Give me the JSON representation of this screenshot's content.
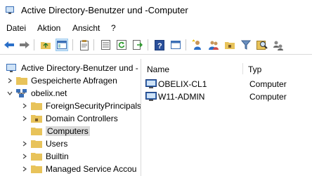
{
  "window": {
    "title": "Active Directory-Benutzer und -Computer"
  },
  "menu": [
    "Datei",
    "Aktion",
    "Ansicht",
    "?"
  ],
  "tree": {
    "root": "Active Directory-Benutzer und -",
    "items": [
      {
        "label": "Gespeicherte Abfragen"
      },
      {
        "label": "obelix.net"
      },
      {
        "label": "ForeignSecurityPrincipals"
      },
      {
        "label": "Domain Controllers"
      },
      {
        "label": "Computers",
        "selected": true
      },
      {
        "label": "Users"
      },
      {
        "label": "Builtin"
      },
      {
        "label": "Managed Service Accou"
      }
    ]
  },
  "list": {
    "columns": [
      "Name",
      "Typ"
    ],
    "rows": [
      {
        "name": "OBELIX-CL1",
        "type": "Computer"
      },
      {
        "name": "W11-ADMIN",
        "type": "Computer"
      }
    ]
  },
  "colors": {
    "folder": "#e8c35a",
    "selection": "#cce4f7",
    "accent": "#3b6fb6"
  }
}
